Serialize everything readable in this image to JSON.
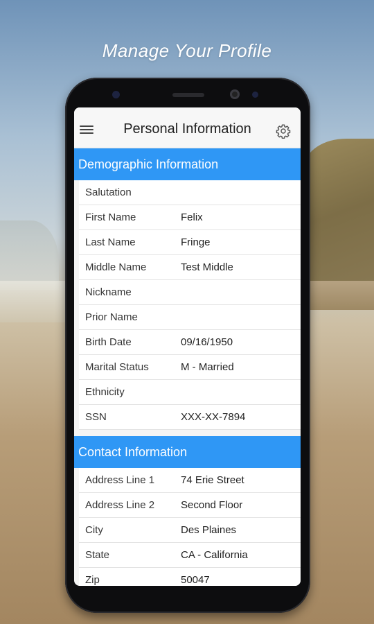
{
  "headline": "Manage Your Profile",
  "header": {
    "title": "Personal Information"
  },
  "icons": {
    "menu": "hamburger-menu-icon",
    "settings": "gear-icon"
  },
  "colors": {
    "section_header_bg": "#2f97f5",
    "section_header_text": "#ffffff"
  },
  "sections": [
    {
      "title": "Demographic Information",
      "rows": [
        {
          "label": "Salutation",
          "value": ""
        },
        {
          "label": "First Name",
          "value": "Felix"
        },
        {
          "label": "Last Name",
          "value": "Fringe"
        },
        {
          "label": "Middle Name",
          "value": "Test Middle"
        },
        {
          "label": "Nickname",
          "value": ""
        },
        {
          "label": "Prior Name",
          "value": ""
        },
        {
          "label": "Birth Date",
          "value": "09/16/1950"
        },
        {
          "label": "Marital Status",
          "value": "M - Married"
        },
        {
          "label": "Ethnicity",
          "value": ""
        },
        {
          "label": "SSN",
          "value": "XXX-XX-7894"
        }
      ]
    },
    {
      "title": "Contact Information",
      "rows": [
        {
          "label": "Address Line 1",
          "value": "74 Erie Street"
        },
        {
          "label": "Address Line 2",
          "value": "Second Floor"
        },
        {
          "label": "City",
          "value": "Des Plaines"
        },
        {
          "label": "State",
          "value": "CA - California"
        },
        {
          "label": "Zip",
          "value": "50047"
        }
      ]
    }
  ]
}
